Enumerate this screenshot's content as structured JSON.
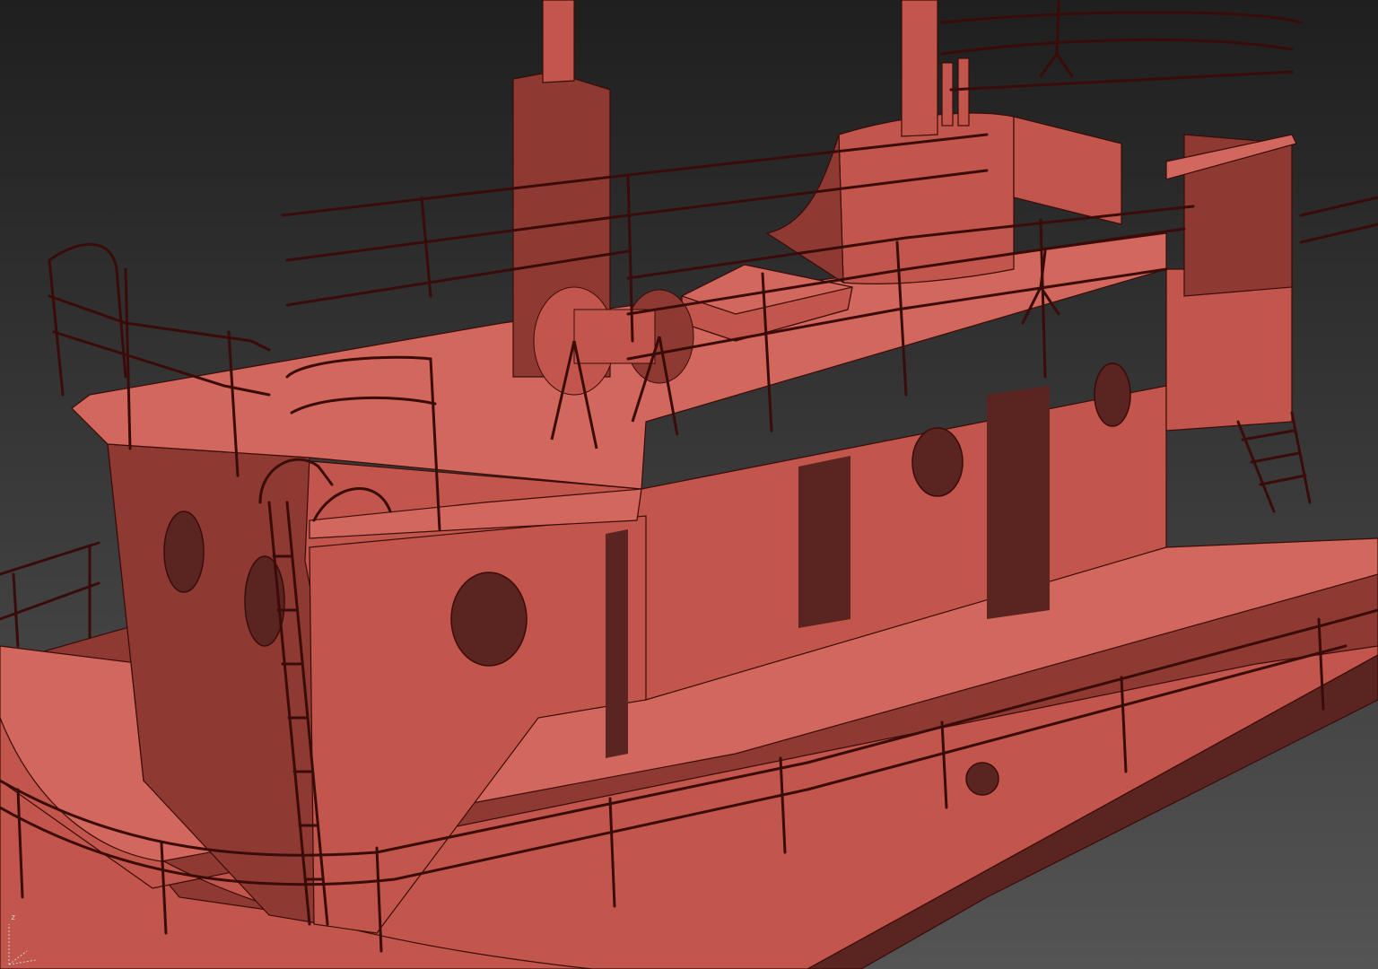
{
  "viewport": {
    "background_top": "#1f1f1f",
    "background_bottom": "#545454"
  },
  "model": {
    "shaded_color": "#c2564c",
    "shaded_dark": "#8e3a33",
    "shaded_light": "#d2685d",
    "shadow_color": "#5a2420",
    "wire_color": "#3a0c09"
  },
  "axis_gizmo": {
    "z_label": "z",
    "color": "#cfcfcf"
  }
}
